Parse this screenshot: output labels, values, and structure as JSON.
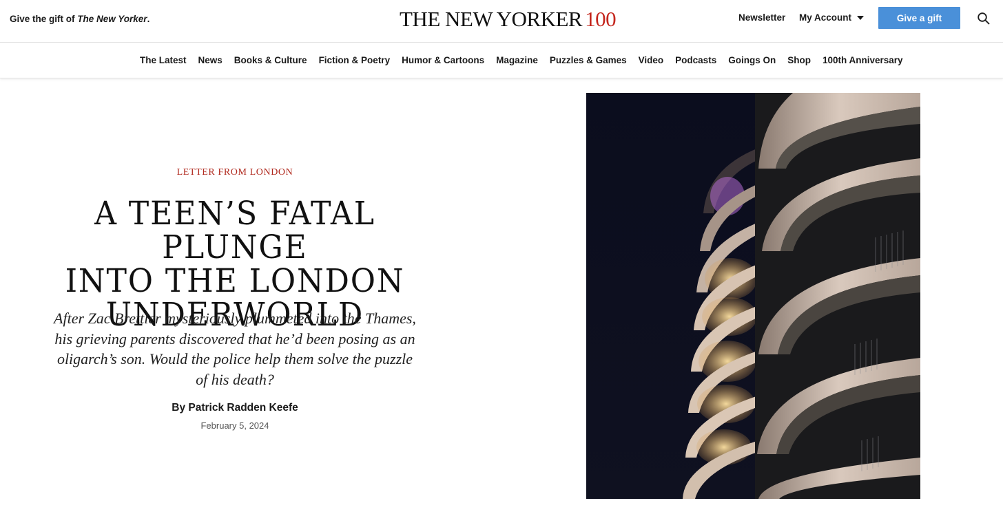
{
  "header": {
    "promo_prefix": "Give the gift of ",
    "promo_title": "The New Yorker",
    "promo_suffix": ".",
    "logo_text": "THE NEW YORKER",
    "logo_number": "100",
    "newsletter_label": "Newsletter",
    "account_label": "My Account",
    "gift_button_label": "Give a gift",
    "search_icon": "search-icon"
  },
  "nav": {
    "items": [
      {
        "label": "The Latest"
      },
      {
        "label": "News"
      },
      {
        "label": "Books & Culture"
      },
      {
        "label": "Fiction & Poetry"
      },
      {
        "label": "Humor & Cartoons"
      },
      {
        "label": "Magazine"
      },
      {
        "label": "Puzzles & Games"
      },
      {
        "label": "Video"
      },
      {
        "label": "Podcasts"
      },
      {
        "label": "Goings On"
      },
      {
        "label": "Shop"
      },
      {
        "label": "100th Anniversary"
      }
    ]
  },
  "article": {
    "rubric": "Letter from London",
    "headline_lines": [
      "A Teen’s Fatal Plunge",
      "into the London",
      "Underworld"
    ],
    "dek": "After Zac Brettler mysteriously plummeted into the Thames, his grieving parents discovered that he’d been posing as an oligarch’s son. Would the police help them solve the puzzle of his death?",
    "byline_prefix": "By ",
    "author": "Patrick Radden Keefe",
    "date": "February 5, 2024"
  },
  "colors": {
    "accent_red": "#c4261d",
    "rubric_red": "#b0281d",
    "gift_button_blue": "#4a90d9"
  }
}
